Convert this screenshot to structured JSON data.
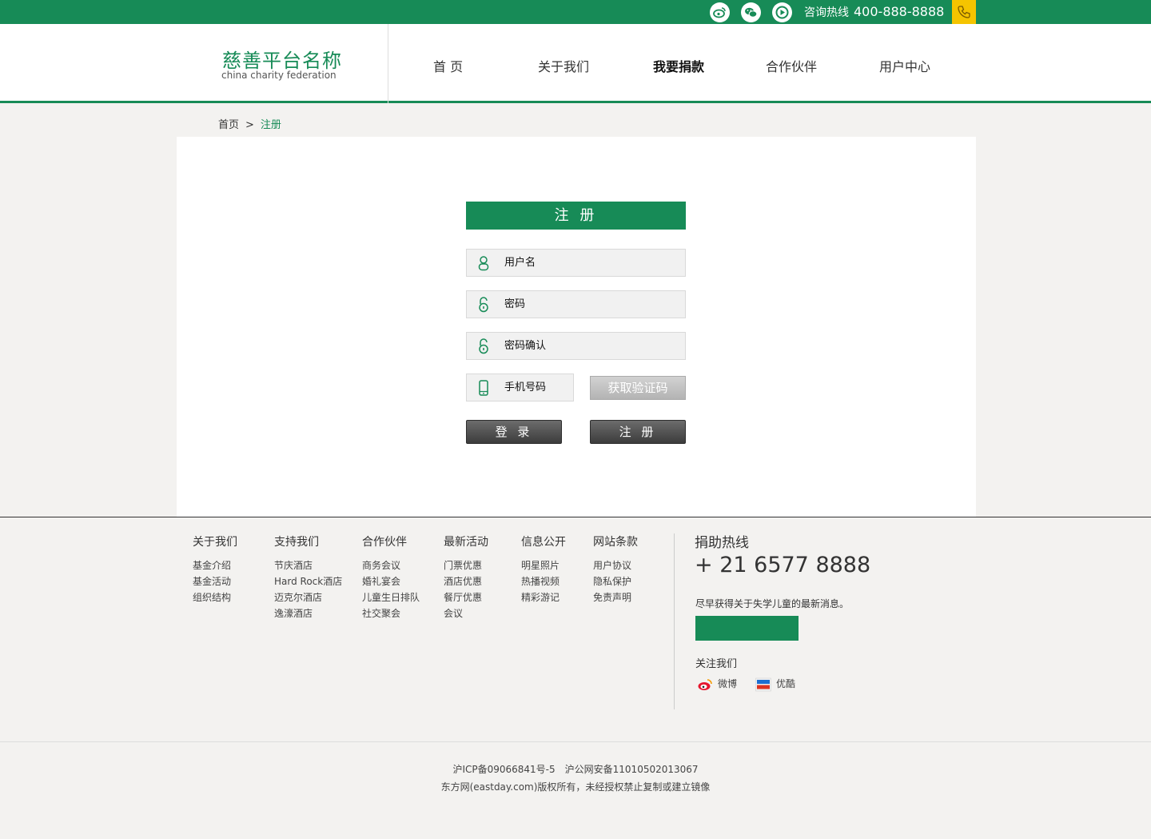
{
  "topbar": {
    "social": [
      {
        "name": "weibo-icon"
      },
      {
        "name": "wechat-icon"
      },
      {
        "name": "youku-icon"
      }
    ],
    "hotline_label": "咨询热线",
    "hotline_number": "400-888-8888",
    "accent": "#178b57",
    "phone_bg": "#f5c400"
  },
  "header": {
    "logo_cn": "慈善平台名称",
    "logo_en": "china charity federation",
    "nav": [
      {
        "label": "首 页",
        "active": false
      },
      {
        "label": "关于我们",
        "active": false
      },
      {
        "label": "我要捐款",
        "active": true
      },
      {
        "label": "合作伙伴",
        "active": false
      },
      {
        "label": "用户中心",
        "active": false
      }
    ]
  },
  "breadcrumb": {
    "home": "首页",
    "separator": ">",
    "current": "注册"
  },
  "register": {
    "title": "注 册",
    "fields": {
      "username": "用户名",
      "password": "密码",
      "confirm": "密码确认",
      "phone": "手机号码"
    },
    "get_code": "获取验证码",
    "login_btn": "登 录",
    "register_btn": "注 册"
  },
  "footer": {
    "columns": [
      {
        "title": "关于我们",
        "items": [
          "基金介绍",
          "基金活动",
          "组织结构"
        ]
      },
      {
        "title": "支持我们",
        "items": [
          "节庆酒店",
          "Hard Rock酒店",
          "迈克尔酒店",
          "逸濠酒店"
        ]
      },
      {
        "title": "合作伙伴",
        "items": [
          "商务会议",
          "婚礼宴会",
          "儿童生日排队",
          "社交聚会"
        ]
      },
      {
        "title": "最新活动",
        "items": [
          "门票优惠",
          "酒店优惠",
          "餐厅优惠",
          "会议"
        ]
      },
      {
        "title": "信息公开",
        "items": [
          "明星照片",
          "热播视频",
          "精彩游记"
        ]
      },
      {
        "title": "网站条款",
        "items": [
          "用户协议",
          "隐私保护",
          "免责声明"
        ]
      }
    ],
    "donate_title": "捐助热线",
    "donate_number": "+ 21 6577 8888",
    "news_text": "尽早获得关于失学儿童的最新消息。",
    "follow_title": "关注我们",
    "follow_weibo": "微博",
    "follow_youku": "优酷",
    "copy_line1": "沪ICP备09066841号-5　沪公网安备11010502013067",
    "copy_line2": "东方网(eastday.com)版权所有，未经授权禁止复制或建立镜像"
  }
}
